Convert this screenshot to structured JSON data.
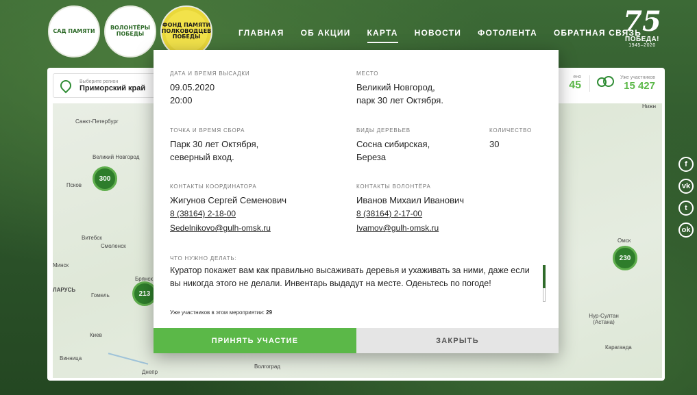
{
  "logos": {
    "garden": "САД ПАМЯТИ",
    "volunteers": "ВОЛОНТЁРЫ ПОБЕДЫ",
    "fund": "ФОНД ПАМЯТИ ПОЛКОВОДЦЕВ ПОБЕДЫ"
  },
  "nav": {
    "items": [
      "ГЛАВНАЯ",
      "ОБ АКЦИИ",
      "КАРТА",
      "НОВОСТИ",
      "ФОТОЛЕНТА",
      "ОБРАТНАЯ СВЯЗЬ"
    ],
    "active": "КАРТА"
  },
  "victory": {
    "num": "75",
    "word": "ПОБЕДА!",
    "years": "1945–2020"
  },
  "mapbar": {
    "region_label": "Выберите регион",
    "region_value": "Приморский край",
    "planted_partial": "45",
    "planted_label_partial": "ено",
    "participants_label": "Уже участников",
    "participants_value": "15 427"
  },
  "map": {
    "cities": [
      "Санкт-Петербург",
      "Великий Новгород",
      "Псков",
      "Витебск",
      "Смоленск",
      "Минск",
      "Брянск",
      "ЛАРУСЬ",
      "Гомель",
      "Киев",
      "Винница",
      "Днепр",
      "Волгоград",
      "Омск",
      "Нур-Султан (Астана)",
      "Караганда",
      "Нижн"
    ],
    "clusters": [
      "300",
      "213",
      "230"
    ]
  },
  "social": [
    "f",
    "vk",
    "tw",
    "ok"
  ],
  "modal": {
    "date_label": "ДАТА И ВРЕМЯ ВЫСАДКИ",
    "date_value": "09.05.2020",
    "time_value": "20:00",
    "place_label": "МЕСТО",
    "place_line1": "Великий Новгород,",
    "place_line2": "парк 30 лет Октября.",
    "meet_label": "ТОЧКА И ВРЕМЯ СБОРА",
    "meet_line1": "Парк 30 лет Октября,",
    "meet_line2": "северный вход.",
    "trees_label": "ВИДЫ ДЕРЕВЬЕВ",
    "trees_line1": "Сосна сибирская,",
    "trees_line2": "Береза",
    "qty_label": "КОЛИЧЕСТВО",
    "qty_value": "30",
    "coord_label": "КОНТАКТЫ КООРДИНАТОРА",
    "coord_name": "Жигунов Сергей Семенович",
    "coord_phone": "8 (38164) 2-18-00",
    "coord_email": "Sedelnikovo@gulh-omsk.ru",
    "vol_label": "КОНТАКТЫ ВОЛОНТЁРА",
    "vol_name": "Иванов Михаил Иванович",
    "vol_phone": "8 (38164) 2-17-00",
    "vol_email": "Ivamov@gulh-omsk.ru",
    "todo_label": "ЧТО НУЖНО ДЕЛАТЬ:",
    "todo_text": "Куратор покажет вам как правильно высаживать деревья и ухаживать за ними, даже если вы никогда этого не делали. Инвентарь выдадут на месте. Оденьтесь по погоде!",
    "already_label": "Уже участников в этом мероприятии:",
    "already_value": "29",
    "join_button": "ПРИНЯТЬ УЧАСТИЕ",
    "close_button": "ЗАКРЫТЬ"
  }
}
